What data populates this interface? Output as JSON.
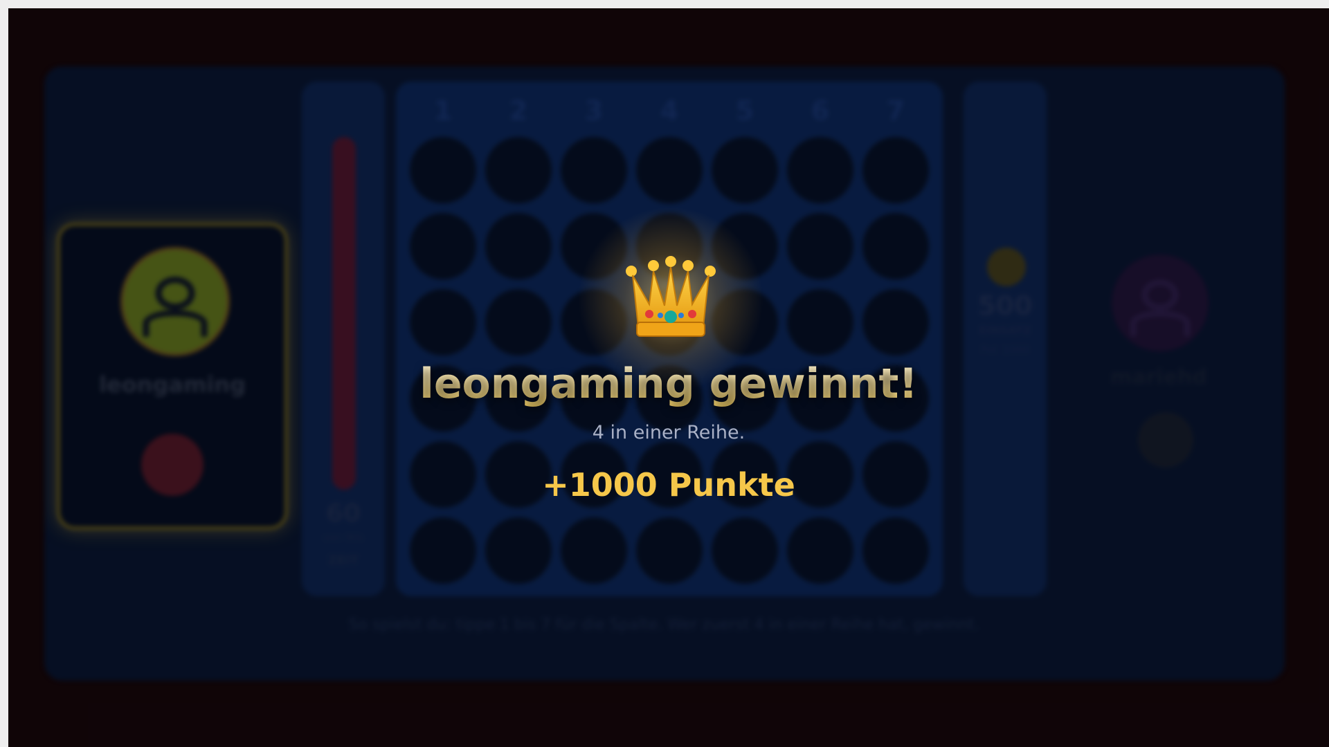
{
  "player1": {
    "name": "leongaming",
    "avatar_icon": "user-icon",
    "chip_color": "#c8263c"
  },
  "player2": {
    "name": "mariehd",
    "avatar_icon": "user-icon",
    "chip_color": "#c7c7c7"
  },
  "timer": {
    "value": "60",
    "sub": "von 90s",
    "label": "ZEIT",
    "icon": "hourglass-icon"
  },
  "board": {
    "columns": [
      "1",
      "2",
      "3",
      "4",
      "5",
      "6",
      "7"
    ],
    "rows": 6
  },
  "stake": {
    "value": "500",
    "label": "EINSATZ",
    "sub": "Pot 1000",
    "icon": "coin-icon"
  },
  "help_text": "So spielst du: tippe 1 bis 7 für die Spalte. Wer zuerst 4 in einer Reihe hat, gewinnt.",
  "win": {
    "icon": "crown-icon",
    "title": "leongaming gewinnt!",
    "reason": "4 in einer Reihe.",
    "points": "+1000 Punkte"
  }
}
